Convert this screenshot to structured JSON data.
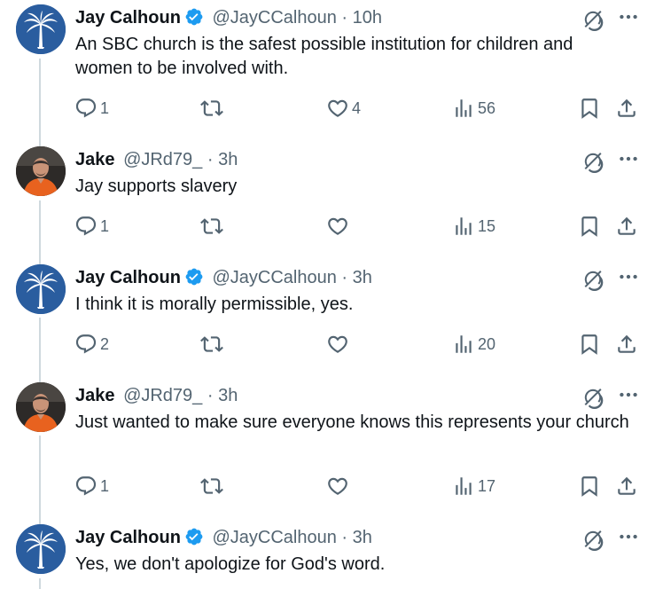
{
  "tweets": [
    {
      "name": "Jay Calhoun",
      "verified": true,
      "handle": "@JayCCalhoun",
      "time": "10h",
      "text": "An SBC church is the safest possible institution for children and women to be involved with.",
      "replies": "1",
      "reposts": "",
      "likes": "4",
      "views": "56",
      "avatar": "palm-tree-flag"
    },
    {
      "name": "Jake",
      "verified": false,
      "handle": "@JRd79_",
      "time": "3h",
      "text": "Jay supports slavery",
      "replies": "1",
      "reposts": "",
      "likes": "",
      "views": "15",
      "avatar": "man-orange-shirt"
    },
    {
      "name": "Jay Calhoun",
      "verified": true,
      "handle": "@JayCCalhoun",
      "time": "3h",
      "text": "I think it is morally permissible, yes.",
      "replies": "2",
      "reposts": "",
      "likes": "",
      "views": "20",
      "avatar": "palm-tree-flag"
    },
    {
      "name": "Jake",
      "verified": false,
      "handle": "@JRd79_",
      "time": "3h",
      "text": "Just wanted to make sure everyone knows this represents your church",
      "replies": "1",
      "reposts": "",
      "likes": "",
      "views": "17",
      "avatar": "man-orange-shirt"
    },
    {
      "name": "Jay Calhoun",
      "verified": true,
      "handle": "@JayCCalhoun",
      "time": "3h",
      "text": "Yes, we don't apologize for God's word.",
      "avatar": "palm-tree-flag"
    }
  ],
  "separator": "·",
  "colors": {
    "verified": "#1d9bf0",
    "muted": "#536471",
    "text": "#0f1419",
    "thread_line": "#cfd9de"
  },
  "icons": [
    "reply-icon",
    "repost-icon",
    "like-icon",
    "views-icon",
    "bookmark-icon",
    "share-icon",
    "grok-icon",
    "more-icon",
    "verified-icon"
  ]
}
